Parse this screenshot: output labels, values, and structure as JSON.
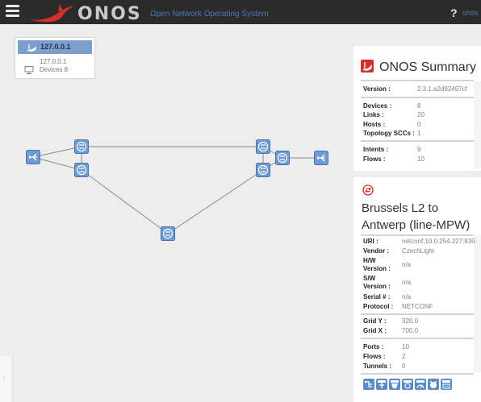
{
  "header": {
    "brand_name": "ONOS",
    "tagline": "Open Network Operating System",
    "help_icon": "?",
    "user": "onos"
  },
  "instance_panel": {
    "title": "127.0.0.1",
    "ip": "127.0.0.1",
    "devices": "Devices 8"
  },
  "summary": {
    "title": "ONOS Summary",
    "version_label": "Version :",
    "version_value": "2.3.1.a2d92497cf",
    "devices_label": "Devices :",
    "devices_value": "8",
    "links_label": "Links :",
    "links_value": "20",
    "hosts_label": "Hosts :",
    "hosts_value": "0",
    "sccs_label": "Topology SCCs :",
    "sccs_value": "1",
    "intents_label": "Intents :",
    "intents_value": "9",
    "flows_label": "Flows :",
    "flows_value": "10"
  },
  "device": {
    "title": "Brussels L2 to Antwerp (line-MPW)",
    "uri_label": "URI :",
    "uri_value": "netconf:10.0.254.227:830",
    "vendor_label": "Vendor :",
    "vendor_value": "CzechLight",
    "hw_label_1": "H/W",
    "hw_label_2": "Version :",
    "hw_value": "n/a",
    "sw_label_1": "S/W",
    "sw_label_2": "Version :",
    "sw_value": "n/a",
    "serial_label": "Serial # :",
    "serial_value": "n/a",
    "protocol_label": "Protocol :",
    "protocol_value": "NETCONF",
    "gridy_label": "Grid Y :",
    "gridy_value": "320.0",
    "gridx_label": "Grid X :",
    "gridx_value": "700.0",
    "ports_label": "Ports :",
    "ports_value": "10",
    "flows_label": "Flows :",
    "flows_value": "2",
    "tunnels_label": "Tunnels :",
    "tunnels_value": "0"
  },
  "toolbar_icons": [
    "show-relatedviews-icon",
    "ports-table-icon",
    "flows-table-icon",
    "groups-table-icon",
    "meters-table-icon",
    "pipeconf-icon",
    "tunnels-icon"
  ],
  "left_tab": "›",
  "colors": {
    "header_bg": "#2b2b2b",
    "accent_blue": "#5c8cc4",
    "onos_red": "#d0322b",
    "panel_bg": "#ffffff",
    "canvas_bg": "#ededed"
  }
}
